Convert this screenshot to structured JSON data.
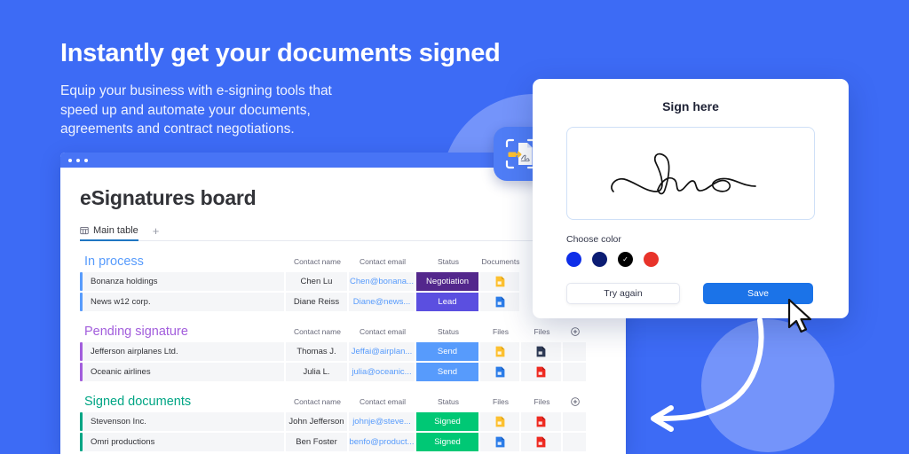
{
  "hero": {
    "headline": "Instantly get your documents signed",
    "subtitle_lines": [
      "Equip your business with e-signing tools that",
      "speed up and automate your documents,",
      "agreements and contract negotiations."
    ]
  },
  "board": {
    "title": "eSignatures board",
    "tab": {
      "label": "Main table",
      "icon": "table-icon"
    },
    "add_tab": "+",
    "groups": [
      {
        "name": "In process",
        "color": "#579BFC",
        "columns": [
          "Contact name",
          "Contact email",
          "Status",
          "Documents"
        ],
        "has_add_column": false,
        "rows": [
          {
            "item": "Bonanza holdings",
            "contact_name": "Chen Lu",
            "contact_email": "Chen@bonana...",
            "status": "Negotiation",
            "status_color": "#53278C",
            "files": [
              "file-yellow-icon"
            ]
          },
          {
            "item": "News w12 corp.",
            "contact_name": "Diane Reiss",
            "contact_email": "Diane@news...",
            "status": "Lead",
            "status_color": "#5B4FE0",
            "files": [
              "file-blue-icon"
            ]
          }
        ]
      },
      {
        "name": "Pending signature",
        "color": "#A25DDC",
        "columns": [
          "Contact name",
          "Contact email",
          "Status",
          "Files",
          "Files"
        ],
        "has_add_column": true,
        "rows": [
          {
            "item": "Jefferson airplanes Ltd.",
            "contact_name": "Thomas J.",
            "contact_email": "Jeffai@airplan...",
            "status": "Send",
            "status_color": "#579BFC",
            "files": [
              "file-yellow-icon",
              "file-dark-icon"
            ]
          },
          {
            "item": "Oceanic airlines",
            "contact_name": "Julia L.",
            "contact_email": "julia@oceanic...",
            "status": "Send",
            "status_color": "#579BFC",
            "files": [
              "file-blue-icon",
              "file-pdf-icon"
            ]
          }
        ]
      },
      {
        "name": "Signed documents",
        "color": "#00A584",
        "columns": [
          "Contact name",
          "Contact email",
          "Status",
          "Files",
          "Files"
        ],
        "has_add_column": true,
        "rows": [
          {
            "item": "Stevenson Inc.",
            "contact_name": "John Jefferson",
            "contact_email": "johnje@steve...",
            "status": "Signed",
            "status_color": "#00C875",
            "files": [
              "file-yellow-icon",
              "file-pdf-icon"
            ]
          },
          {
            "item": "Omri productions",
            "contact_name": "Ben Foster",
            "contact_email": "benfo@product...",
            "status": "Signed",
            "status_color": "#00C875",
            "files": [
              "file-blue-icon",
              "file-pdf-icon"
            ]
          }
        ]
      }
    ]
  },
  "signature_card": {
    "title": "Sign here",
    "choose_color_label": "Choose color",
    "colors": [
      {
        "name": "bright-blue",
        "hex": "#0E2EE8",
        "selected": false
      },
      {
        "name": "navy",
        "hex": "#0B1C73",
        "selected": false
      },
      {
        "name": "black",
        "hex": "#000000",
        "selected": true
      },
      {
        "name": "red",
        "hex": "#E8332A",
        "selected": false
      }
    ],
    "try_again_label": "Try again",
    "save_label": "Save"
  },
  "app_icon": {
    "name": "document-sign-scan-icon"
  },
  "theme": {
    "background": "#3D6BF5",
    "circle": "#7E9BFA",
    "primary_button": "#1B73E8"
  }
}
